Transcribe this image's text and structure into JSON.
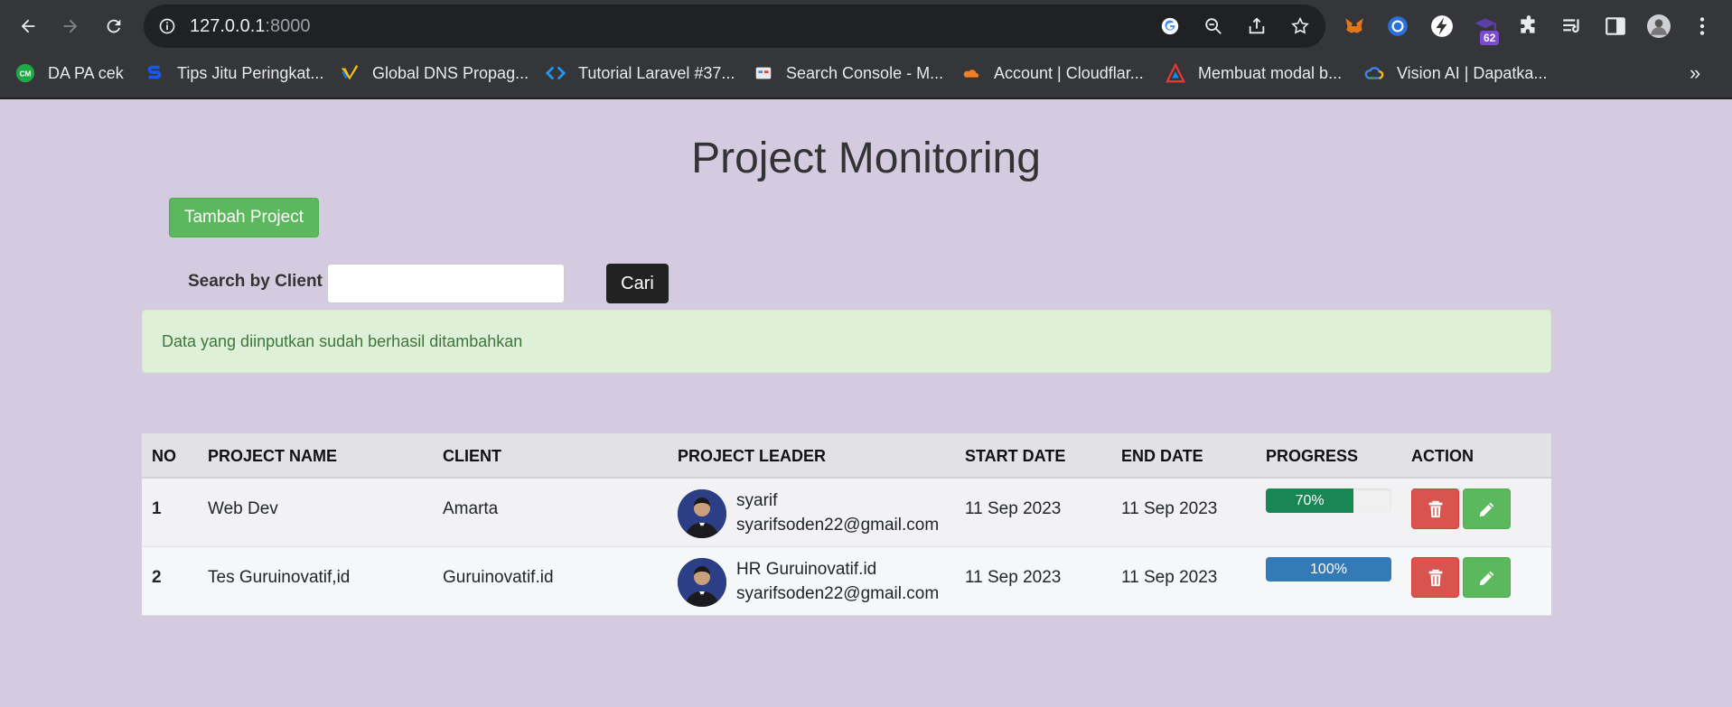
{
  "browser": {
    "url_host": "127.0.0.1",
    "url_port": ":8000",
    "extension_badge": "62",
    "bookmarks": [
      {
        "label": "DA PA cek",
        "icon": "cm-icon"
      },
      {
        "label": "Tips Jitu Peringkat...",
        "icon": "s-icon"
      },
      {
        "label": "Global DNS Propag...",
        "icon": "dns-check-icon"
      },
      {
        "label": "Tutorial Laravel #37...",
        "icon": "code-icon"
      },
      {
        "label": "Search Console - M...",
        "icon": "search-console-icon"
      },
      {
        "label": "Account | Cloudflar...",
        "icon": "cloudflare-icon"
      },
      {
        "label": "Membuat modal b...",
        "icon": "triangle-logo-icon"
      },
      {
        "label": "Vision AI | Dapatka...",
        "icon": "google-cloud-icon"
      }
    ],
    "bookmarks_more": "»"
  },
  "page": {
    "title": "Project Monitoring",
    "add_button": "Tambah Project",
    "search_label": "Search by Client",
    "search_value": "",
    "search_button": "Cari",
    "alert": "Data yang diinputkan sudah berhasil ditambahkan"
  },
  "table": {
    "headers": [
      "NO",
      "PROJECT NAME",
      "CLIENT",
      "PROJECT LEADER",
      "START DATE",
      "END DATE",
      "PROGRESS",
      "ACTION"
    ],
    "rows": [
      {
        "no": "1",
        "project": "Web Dev",
        "client": "Amarta",
        "leader": "syarif",
        "email": "syarifsoden22@gmail.com",
        "start": "11 Sep 2023",
        "end": "11 Sep 2023",
        "progress_label": "70%",
        "progress": 0.7,
        "bar_color": "#198754"
      },
      {
        "no": "2",
        "project": "Tes Guruinovatif,id",
        "client": "Guruinovatif.id",
        "leader": "HR Guruinovatif.id",
        "email": "syarifsoden22@gmail.com",
        "start": "11 Sep 2023",
        "end": "11 Sep 2023",
        "progress_label": "100%",
        "progress": 1.0,
        "bar_color": "#337ab7"
      }
    ]
  },
  "colors": {
    "page_bg": "#d4cbe1",
    "success": "#5cb85c",
    "danger": "#d9534f",
    "alert_bg": "#dff0d8",
    "alert_text": "#3c763d"
  }
}
